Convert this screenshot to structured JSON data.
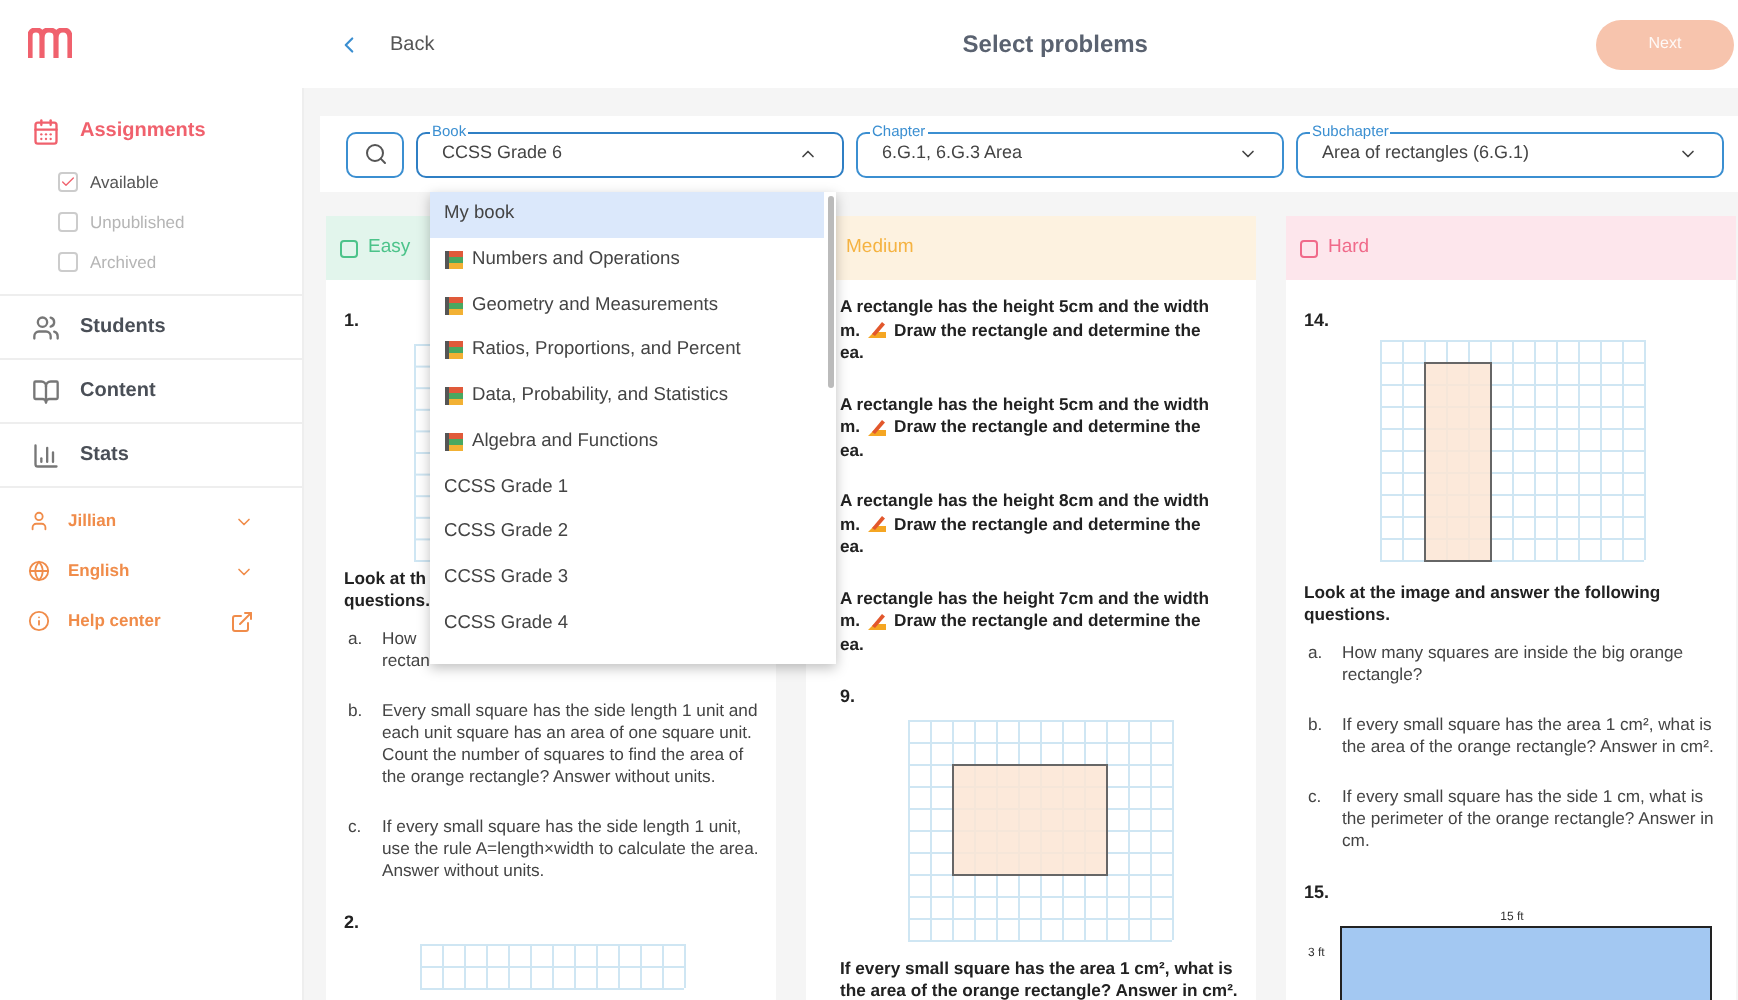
{
  "header": {
    "back": "Back",
    "title": "Select problems",
    "next": {
      "label": "Next",
      "disabled": true
    }
  },
  "sidebar": {
    "nav": [
      {
        "label": "Assignments",
        "selected": true,
        "children": [
          {
            "label": "Available",
            "checked": true,
            "disabled": false
          },
          {
            "label": "Unpublished",
            "checked": false,
            "disabled": true
          },
          {
            "label": "Archived",
            "checked": false,
            "disabled": true
          }
        ]
      },
      {
        "label": "Students",
        "selected": false
      },
      {
        "label": "Content",
        "selected": false
      },
      {
        "label": "Stats",
        "selected": false
      }
    ],
    "account": [
      {
        "label": "Jillian"
      },
      {
        "label": "English"
      },
      {
        "label": "Help center"
      }
    ]
  },
  "filters": [
    {
      "label": "Book",
      "value": "CCSS Grade 6",
      "expanded": true
    },
    {
      "label": "Chapter",
      "value": "6.G.1, 6.G.3 Area",
      "expanded": false
    },
    {
      "label": "Subchapter",
      "value": "Area of rectangles (6.G.1)",
      "expanded": false
    }
  ],
  "book_menu": [
    {
      "label": "My book",
      "kind": "plain",
      "selected": true
    },
    {
      "label": "Numbers and Operations",
      "kind": "book",
      "selected": false
    },
    {
      "label": "Geometry and Measurements",
      "kind": "book",
      "selected": false
    },
    {
      "label": "Ratios, Proportions, and Percent",
      "kind": "book",
      "selected": false
    },
    {
      "label": "Data, Probability, and Statistics",
      "kind": "book",
      "selected": false
    },
    {
      "label": "Algebra and Functions",
      "kind": "book",
      "selected": false
    },
    {
      "label": "CCSS Grade 1",
      "kind": "plain",
      "selected": false
    },
    {
      "label": "CCSS Grade 2",
      "kind": "plain",
      "selected": false
    },
    {
      "label": "CCSS Grade 3",
      "kind": "plain",
      "selected": false
    },
    {
      "label": "CCSS Grade 4",
      "kind": "plain",
      "selected": false
    }
  ],
  "columns": [
    {
      "label": "Easy",
      "color": "#4cc38a",
      "checked": false,
      "blocks": [
        {
          "kind": "number",
          "text": "1."
        },
        {
          "kind": "figure"
        },
        {
          "kind": "prompt",
          "lines": [
            "Look at th",
            "questions."
          ]
        },
        {
          "kind": "subitem",
          "letter": "a.",
          "lines": [
            "How",
            "rectan"
          ]
        },
        {
          "kind": "subitem",
          "letter": "b.",
          "lines": [
            "Every small square has the side length 1 unit and each unit square has an area of one square unit. Count the number of squares to find the area of the orange rectangle? Answer without units."
          ]
        },
        {
          "kind": "subitem",
          "letter": "c.",
          "lines": [
            "If every small square has the side length 1 unit, use the rule A=length×width to calculate the area. Answer without units."
          ]
        },
        {
          "kind": "number",
          "text": "2."
        },
        {
          "kind": "figure"
        }
      ]
    },
    {
      "label": "Medium",
      "color": "#f5b342",
      "blocks": [
        {
          "kind": "task",
          "first": "A rectangle has the height 5cm and the width",
          "cut_start": "m.",
          "rest": "Draw the rectangle and determine the",
          "cut_end": "ea."
        },
        {
          "kind": "task",
          "first": "A rectangle has the height 5cm and the width",
          "cut_start": "m.",
          "rest": "Draw the rectangle and determine the",
          "cut_end": "ea."
        },
        {
          "kind": "task",
          "first": "A rectangle has the height 8cm and the width",
          "cut_start": "m.",
          "rest": "Draw the rectangle and determine the",
          "cut_end": "ea."
        },
        {
          "kind": "task",
          "first": "A rectangle has the height 7cm and the width",
          "cut_start": "m.",
          "rest": "Draw the rectangle and determine the",
          "cut_end": "ea."
        },
        {
          "kind": "number",
          "text": "9."
        },
        {
          "kind": "figure"
        },
        {
          "kind": "prompt",
          "lines": [
            "If every small square has the area 1 cm², what is the area of the orange rectangle? Answer in cm²."
          ]
        }
      ]
    },
    {
      "label": "Hard",
      "color": "#f06a8a",
      "checked": false,
      "blocks": [
        {
          "kind": "number",
          "text": "14."
        },
        {
          "kind": "figure"
        },
        {
          "kind": "prompt",
          "lines": [
            "Look at the image and answer the following questions."
          ]
        },
        {
          "kind": "subitem",
          "letter": "a.",
          "lines": [
            "How many squares are inside the big orange rectangle?"
          ]
        },
        {
          "kind": "subitem",
          "letter": "b.",
          "lines": [
            "If every small square has the area 1 cm², what is the area of the orange rectangle? Answer in cm²."
          ]
        },
        {
          "kind": "subitem",
          "letter": "c.",
          "lines": [
            "If every small square has the side 1 cm, what is the perimeter of the orange rectangle? Answer in cm."
          ]
        },
        {
          "kind": "number",
          "text": "15."
        },
        {
          "kind": "figure",
          "top_label": "15 ft",
          "side_label": "3 ft"
        }
      ]
    }
  ]
}
